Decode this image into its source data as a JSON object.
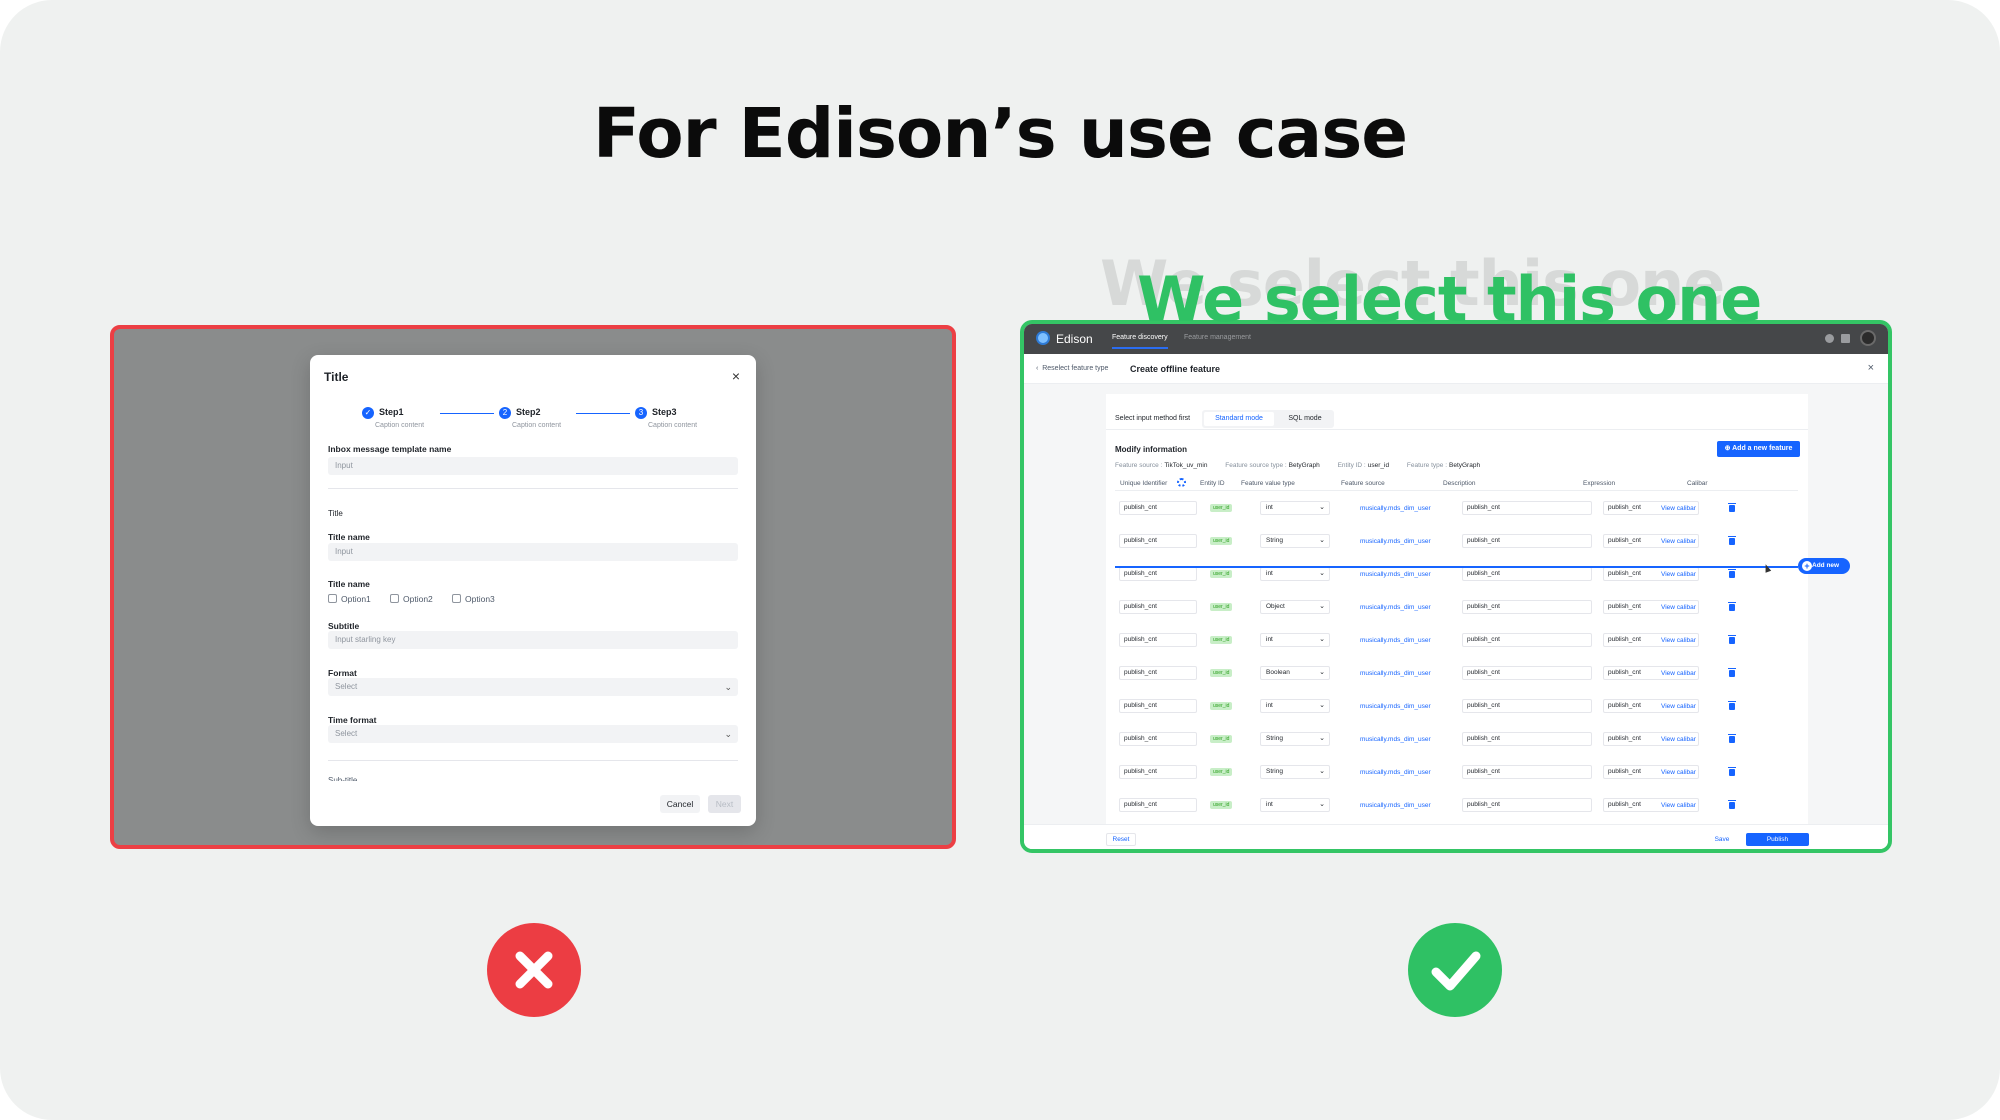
{
  "heading": "For Edison’s use case",
  "ghost_text": "We select this one",
  "selected_label": "We select this one",
  "left_modal": {
    "title": "Title",
    "close": "×",
    "steps": [
      {
        "num": "✓",
        "label": "Step1",
        "caption": "Caption content"
      },
      {
        "num": "2",
        "label": "Step2",
        "caption": "Caption content"
      },
      {
        "num": "3",
        "label": "Step3",
        "caption": "Caption content"
      }
    ],
    "template_name_label": "Inbox message template name",
    "template_name_placeholder": "Input",
    "section_title": "Title",
    "title_name_label": "Title name",
    "title_name_placeholder": "Input",
    "title_name2_label": "Title name",
    "options": [
      "Option1",
      "Option2",
      "Option3"
    ],
    "subtitle_label": "Subtitle",
    "subtitle_placeholder": "Input starling key",
    "format_label": "Format",
    "format_placeholder": "Select",
    "time_format_label": "Time format",
    "time_format_placeholder": "Select",
    "subtitle_cut_label": "Sub-title",
    "cancel": "Cancel",
    "next": "Next"
  },
  "right_app": {
    "app_name": "Edison",
    "nav": [
      "Feature discovery",
      "Feature management"
    ],
    "back_link": "Reselect feature type",
    "page_title": "Create offline feature",
    "close": "×",
    "mode_label": "Select input method first",
    "modes": [
      "Standard mode",
      "SQL mode"
    ],
    "modify_title": "Modify information",
    "add_feature": "Add a new feature",
    "meta": {
      "source_label": "Feature source :",
      "source_value": "TikTok_uv_min",
      "source_type_label": "Feature source type :",
      "source_type_value": "BetyGraph",
      "entity_label": "Entity ID :",
      "entity_value": "user_id",
      "type_label": "Feature type :",
      "type_value": "BetyGraph"
    },
    "columns": [
      "Unique Identifier",
      "Entity ID",
      "Feature value type",
      "Feature source",
      "Description",
      "Expression",
      "Calibar"
    ],
    "rows": [
      {
        "id": "publish_cnt",
        "entity": "user_id",
        "type": "int",
        "source": "musically.mds_dim_user",
        "desc": "publish_cnt",
        "expr": "publish_cnt",
        "calibar": "View calibar"
      },
      {
        "id": "publish_cnt",
        "entity": "user_id",
        "type": "String",
        "source": "musically.mds_dim_user",
        "desc": "publish_cnt",
        "expr": "publish_cnt",
        "calibar": "View calibar"
      },
      {
        "id": "publish_cnt",
        "entity": "user_id",
        "type": "int",
        "source": "musically.mds_dim_user",
        "desc": "publish_cnt",
        "expr": "publish_cnt",
        "calibar": "View calibar"
      },
      {
        "id": "publish_cnt",
        "entity": "user_id",
        "type": "Object",
        "source": "musically.mds_dim_user",
        "desc": "publish_cnt",
        "expr": "publish_cnt",
        "calibar": "View calibar"
      },
      {
        "id": "publish_cnt",
        "entity": "user_id",
        "type": "int",
        "source": "musically.mds_dim_user",
        "desc": "publish_cnt",
        "expr": "publish_cnt",
        "calibar": "View calibar"
      },
      {
        "id": "publish_cnt",
        "entity": "user_id",
        "type": "Boolean",
        "source": "musically.mds_dim_user",
        "desc": "publish_cnt",
        "expr": "publish_cnt",
        "calibar": "View calibar"
      },
      {
        "id": "publish_cnt",
        "entity": "user_id",
        "type": "int",
        "source": "musically.mds_dim_user",
        "desc": "publish_cnt",
        "expr": "publish_cnt",
        "calibar": "View calibar"
      },
      {
        "id": "publish_cnt",
        "entity": "user_id",
        "type": "String",
        "source": "musically.mds_dim_user",
        "desc": "publish_cnt",
        "expr": "publish_cnt",
        "calibar": "View calibar"
      },
      {
        "id": "publish_cnt",
        "entity": "user_id",
        "type": "String",
        "source": "musically.mds_dim_user",
        "desc": "publish_cnt",
        "expr": "publish_cnt",
        "calibar": "View calibar"
      },
      {
        "id": "publish_cnt",
        "entity": "user_id",
        "type": "int",
        "source": "musically.mds_dim_user",
        "desc": "publish_cnt",
        "expr": "publish_cnt",
        "calibar": "View calibar"
      }
    ],
    "add_new": "Add new",
    "reset": "Reset",
    "save": "Save",
    "publish": "Publish"
  },
  "colors": {
    "rejected": "#ec3d43",
    "selected": "#2fc164",
    "accent": "#1664ff"
  }
}
